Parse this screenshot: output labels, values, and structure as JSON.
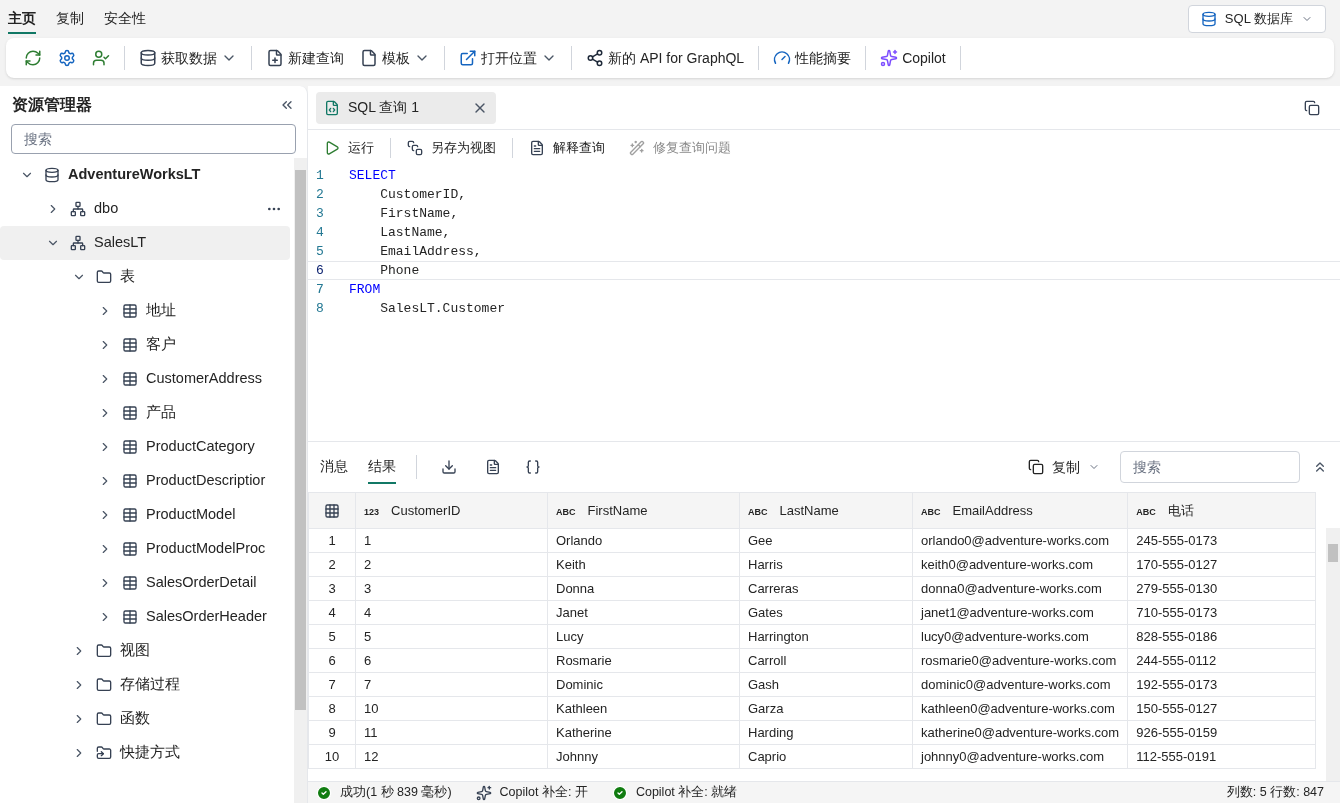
{
  "ribbon_tabs": [
    {
      "label": "主页",
      "selected": true
    },
    {
      "label": "复制",
      "selected": false
    },
    {
      "label": "安全性",
      "selected": false
    }
  ],
  "db_switcher": {
    "label": "SQL 数据库"
  },
  "toolbar": [
    {
      "kind": "refresh",
      "dropdown": false
    },
    {
      "kind": "settings",
      "dropdown": false
    },
    {
      "kind": "person",
      "dropdown": false
    },
    {
      "kind": "sep"
    },
    {
      "kind": "database",
      "label": "获取数据",
      "dropdown": true
    },
    {
      "kind": "sep"
    },
    {
      "kind": "newquery",
      "label": "新建查询",
      "dropdown": false
    },
    {
      "kind": "file",
      "label": "模板",
      "dropdown": true
    },
    {
      "kind": "sep"
    },
    {
      "kind": "external",
      "label": "打开位置",
      "dropdown": true
    },
    {
      "kind": "sep"
    },
    {
      "kind": "graph",
      "label": "新的 API for GraphQL",
      "dropdown": false
    },
    {
      "kind": "sep"
    },
    {
      "kind": "gauge",
      "label": "性能摘要",
      "dropdown": false
    },
    {
      "kind": "sep"
    },
    {
      "kind": "copilot",
      "label": "Copilot",
      "dropdown": false
    },
    {
      "kind": "sep"
    }
  ],
  "explorer": {
    "title": "资源管理器",
    "search": {
      "placeholder": "搜索"
    },
    "tree": [
      {
        "label": "AdventureWorksLT",
        "kind": "database",
        "expanded": true,
        "selected": false,
        "children": [
          {
            "label": "dbo",
            "kind": "schema",
            "expanded": false,
            "selected": false,
            "more": true
          },
          {
            "label": "SalesLT",
            "kind": "schema",
            "expanded": true,
            "selected": true,
            "children": [
              {
                "label": "表",
                "kind": "folder",
                "expanded": true,
                "selected": false,
                "children": [
                  {
                    "label": "地址",
                    "kind": "table",
                    "expanded": false,
                    "selected": false
                  },
                  {
                    "label": "客户",
                    "kind": "table",
                    "expanded": false,
                    "selected": false
                  },
                  {
                    "label": "CustomerAddress",
                    "kind": "table",
                    "expanded": false,
                    "selected": false
                  },
                  {
                    "label": "产品",
                    "kind": "table",
                    "expanded": false,
                    "selected": false
                  },
                  {
                    "label": "ProductCategory",
                    "kind": "table",
                    "expanded": false,
                    "selected": false
                  },
                  {
                    "label": "ProductDescriptior",
                    "kind": "table",
                    "expanded": false,
                    "selected": false
                  },
                  {
                    "label": "ProductModel",
                    "kind": "table",
                    "expanded": false,
                    "selected": false
                  },
                  {
                    "label": "ProductModelProc",
                    "kind": "table",
                    "expanded": false,
                    "selected": false
                  },
                  {
                    "label": "SalesOrderDetail",
                    "kind": "table",
                    "expanded": false,
                    "selected": false
                  },
                  {
                    "label": "SalesOrderHeader",
                    "kind": "table",
                    "expanded": false,
                    "selected": false
                  }
                ]
              },
              {
                "label": "视图",
                "kind": "folder",
                "expanded": false,
                "selected": false
              },
              {
                "label": "存储过程",
                "kind": "folder",
                "expanded": false,
                "selected": false
              },
              {
                "label": "函数",
                "kind": "folder",
                "expanded": false,
                "selected": false
              },
              {
                "label": "快捷方式",
                "kind": "shortcut",
                "expanded": false,
                "selected": false
              }
            ]
          }
        ]
      }
    ]
  },
  "editor_tab": {
    "label": "SQL 查询 1"
  },
  "editor_toolbar": [
    {
      "kind": "run",
      "label": "运行",
      "disabled": false
    },
    {
      "kind": "saveview",
      "label": "另存为视图",
      "disabled": false
    },
    {
      "kind": "explain",
      "label": "解释查询",
      "disabled": false
    },
    {
      "kind": "fix",
      "label": "修复查询问题",
      "disabled": true
    }
  ],
  "code": [
    {
      "number": "1",
      "text": "SELECT",
      "kind": "keyword",
      "current": false
    },
    {
      "number": "2",
      "text": "    CustomerID,",
      "kind": "plain",
      "current": false
    },
    {
      "number": "3",
      "text": "    FirstName,",
      "kind": "plain",
      "current": false
    },
    {
      "number": "4",
      "text": "    LastName,",
      "kind": "plain",
      "current": false
    },
    {
      "number": "5",
      "text": "    EmailAddress,",
      "kind": "plain",
      "current": false
    },
    {
      "number": "6",
      "text": "    Phone",
      "kind": "plain",
      "current": true
    },
    {
      "number": "7",
      "text": "FROM",
      "kind": "keyword",
      "current": false
    },
    {
      "number": "8",
      "text": "    SalesLT.Customer",
      "kind": "plain",
      "current": false
    }
  ],
  "results": {
    "tabs": [
      {
        "label": "消息",
        "selected": false
      },
      {
        "label": "结果",
        "selected": true
      }
    ],
    "copy": {
      "label": "复制"
    },
    "search": {
      "placeholder": "搜索"
    },
    "columns": [
      {
        "kind": "index"
      },
      {
        "type": "123",
        "label": "CustomerID"
      },
      {
        "type": "ABC",
        "label": "FirstName"
      },
      {
        "type": "ABC",
        "label": "LastName"
      },
      {
        "type": "ABC",
        "label": "EmailAddress"
      },
      {
        "type": "ABC",
        "label": "电话"
      }
    ],
    "rows": [
      [
        "1",
        "1",
        "Orlando",
        "Gee",
        "orlando0@adventure-works.com",
        "245-555-0173"
      ],
      [
        "2",
        "2",
        "Keith",
        "Harris",
        "keith0@adventure-works.com",
        "170-555-0127"
      ],
      [
        "3",
        "3",
        "Donna",
        "Carreras",
        "donna0@adventure-works.com",
        "279-555-0130"
      ],
      [
        "4",
        "4",
        "Janet",
        "Gates",
        "janet1@adventure-works.com",
        "710-555-0173"
      ],
      [
        "5",
        "5",
        "Lucy",
        "Harrington",
        "lucy0@adventure-works.com",
        "828-555-0186"
      ],
      [
        "6",
        "6",
        "Rosmarie",
        "Carroll",
        "rosmarie0@adventure-works.com",
        "244-555-0112"
      ],
      [
        "7",
        "7",
        "Dominic",
        "Gash",
        "dominic0@adventure-works.com",
        "192-555-0173"
      ],
      [
        "8",
        "10",
        "Kathleen",
        "Garza",
        "kathleen0@adventure-works.com",
        "150-555-0127"
      ],
      [
        "9",
        "11",
        "Katherine",
        "Harding",
        "katherine0@adventure-works.com",
        "926-555-0159"
      ],
      [
        "10",
        "12",
        "Johnny",
        "Caprio",
        "johnny0@adventure-works.com",
        "112-555-0191"
      ]
    ]
  },
  "status_bar": {
    "items": [
      {
        "kind": "success",
        "label": "成功(1 秒 839 毫秒)"
      },
      {
        "kind": "copilot",
        "label": "Copilot 补全: 开"
      },
      {
        "kind": "success",
        "label": "Copilot 补全: 就绪"
      }
    ],
    "summary": "列数: 5 行数: 847"
  }
}
